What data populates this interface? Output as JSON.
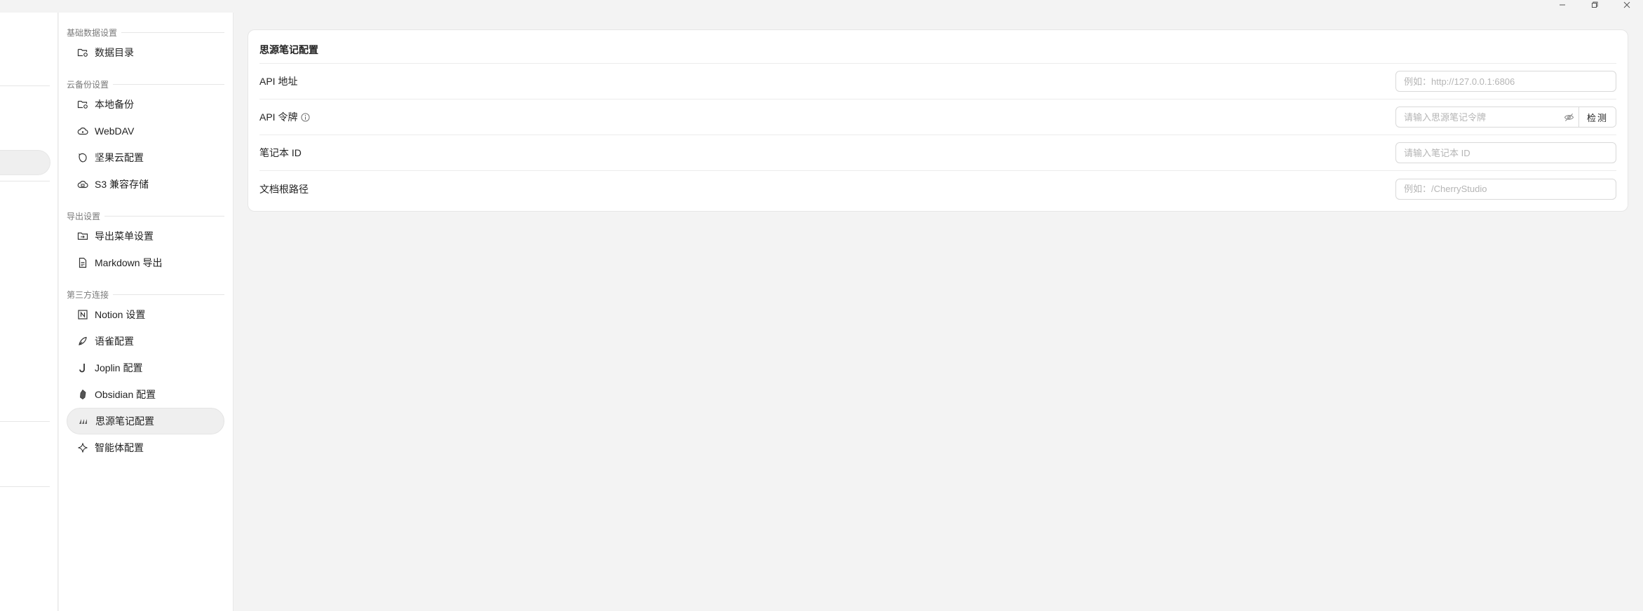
{
  "window": {
    "controls": [
      "minimize",
      "maximize",
      "close"
    ]
  },
  "nav": {
    "groups": [
      {
        "title": "基础数据设置",
        "items": [
          {
            "label": "数据目录",
            "icon": "folder-settings-icon"
          }
        ]
      },
      {
        "title": "云备份设置",
        "items": [
          {
            "label": "本地备份",
            "icon": "folder-settings-icon"
          },
          {
            "label": "WebDAV",
            "icon": "cloud-icon"
          },
          {
            "label": "坚果云配置",
            "icon": "nut-icon"
          },
          {
            "label": "S3 兼容存储",
            "icon": "cloud-storage-icon"
          }
        ]
      },
      {
        "title": "导出设置",
        "items": [
          {
            "label": "导出菜单设置",
            "icon": "export-folder-icon"
          },
          {
            "label": "Markdown 导出",
            "icon": "document-icon"
          }
        ]
      },
      {
        "title": "第三方连接",
        "items": [
          {
            "label": "Notion 设置",
            "icon": "notion-icon"
          },
          {
            "label": "语雀配置",
            "icon": "yuque-icon"
          },
          {
            "label": "Joplin 配置",
            "icon": "joplin-icon"
          },
          {
            "label": "Obsidian 配置",
            "icon": "obsidian-icon"
          },
          {
            "label": "思源笔记配置",
            "icon": "siyuan-icon",
            "active": true
          },
          {
            "label": "智能体配置",
            "icon": "sparkle-icon"
          }
        ]
      }
    ]
  },
  "main": {
    "title": "思源笔记配置",
    "rows": [
      {
        "label": "API 地址",
        "placeholder": "例如：http://127.0.0.1:6806",
        "value": ""
      },
      {
        "label": "API 令牌",
        "placeholder": "请输入思源笔记令牌",
        "value": "",
        "check_label": "检测"
      },
      {
        "label": "笔记本 ID",
        "placeholder": "请输入笔记本 ID",
        "value": ""
      },
      {
        "label": "文档根路径",
        "placeholder": "例如：/CherryStudio",
        "value": ""
      }
    ]
  }
}
